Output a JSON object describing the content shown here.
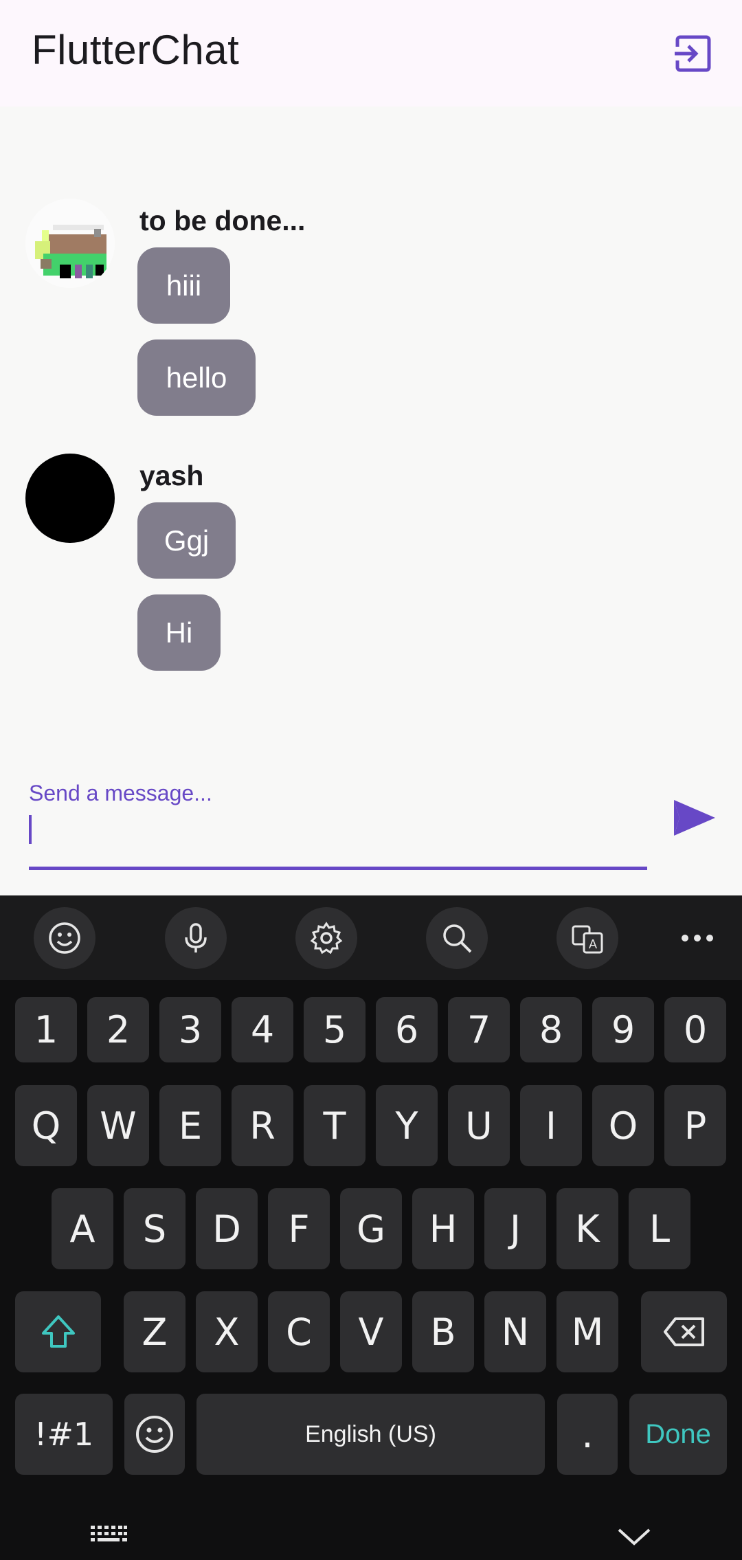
{
  "app": {
    "title": "FlutterChat",
    "accent_color": "#6748c6",
    "logout_icon": "logout-icon"
  },
  "messages": [
    {
      "username": "to be done...",
      "avatar": "pixel-art-avatar",
      "texts": [
        "hiii",
        "hello"
      ]
    },
    {
      "username": "yash",
      "avatar": "black-circle-avatar",
      "texts": [
        "Ggj",
        "Hi"
      ]
    }
  ],
  "input": {
    "label": "Send a message...",
    "value": "",
    "send_icon": "send-icon"
  },
  "keyboard": {
    "toolbar": [
      "emoji-icon",
      "mic-icon",
      "settings-icon",
      "search-icon",
      "translate-icon",
      "more-icon"
    ],
    "numbers": [
      "1",
      "2",
      "3",
      "4",
      "5",
      "6",
      "7",
      "8",
      "9",
      "0"
    ],
    "row1": [
      "Q",
      "W",
      "E",
      "R",
      "T",
      "Y",
      "U",
      "I",
      "O",
      "P"
    ],
    "row2": [
      "A",
      "S",
      "D",
      "F",
      "G",
      "H",
      "J",
      "K",
      "L"
    ],
    "row3": [
      "Z",
      "X",
      "C",
      "V",
      "B",
      "N",
      "M"
    ],
    "symbols_label": "!#1",
    "space_label": "English (US)",
    "period_label": ".",
    "done_label": "Done",
    "done_color": "#3fc7c0"
  }
}
